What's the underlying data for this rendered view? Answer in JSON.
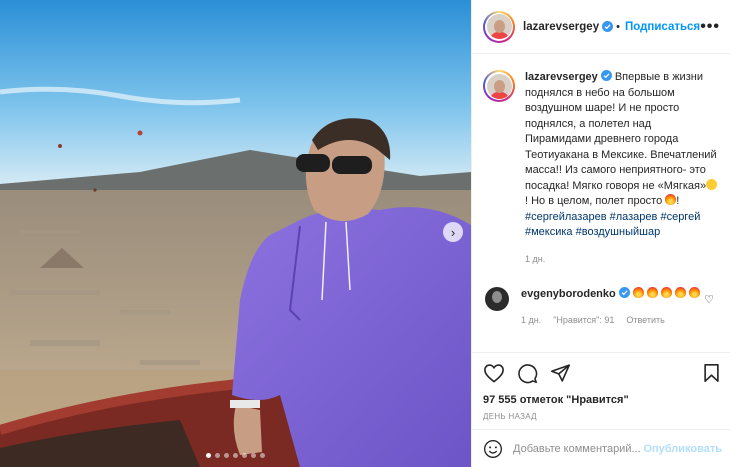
{
  "post": {
    "author": "lazarevsergey",
    "follow_label": "Подписаться",
    "more_label": "•••",
    "caption_prefix": "Впервые в жизни поднялся в небо на большом воздушном шаре! И не просто поднялся, а полетел над Пирамидами древнего города Теотиуакана в Мексике. Впечатлений масса!! Из самого неприятного- это посадка! Мягко говоря не «Мягкая»",
    "caption_mid": "! Но в целом, полет просто",
    "hashtags": [
      "#сергейлазарев",
      "#лазарев",
      "#сергей",
      "#мексика",
      "#воздушныйшар"
    ],
    "caption_time": "1 дн.",
    "comment": {
      "author": "evgenyborodenko",
      "time": "1 дн.",
      "likes_label": "\"Нравится\": 91",
      "reply_label": "Ответить"
    },
    "likes_text": "97 555 отметок \"Нравится\"",
    "posted_ago": "ДЕНЬ НАЗАД",
    "comment_placeholder": "Добавьте комментарий...",
    "publish_label": "Опубликовать",
    "carousel": {
      "slides": 7,
      "active_index": 0
    }
  },
  "colors": {
    "link_blue": "#0095f6",
    "hashtag": "#00376b",
    "muted": "#8e8e8e",
    "publish_disabled": "#b2dffc"
  },
  "icons": [
    "verified-icon",
    "more-icon",
    "heart-icon",
    "comment-icon",
    "share-icon",
    "save-icon",
    "emoji-icon",
    "chevron-right-icon"
  ]
}
